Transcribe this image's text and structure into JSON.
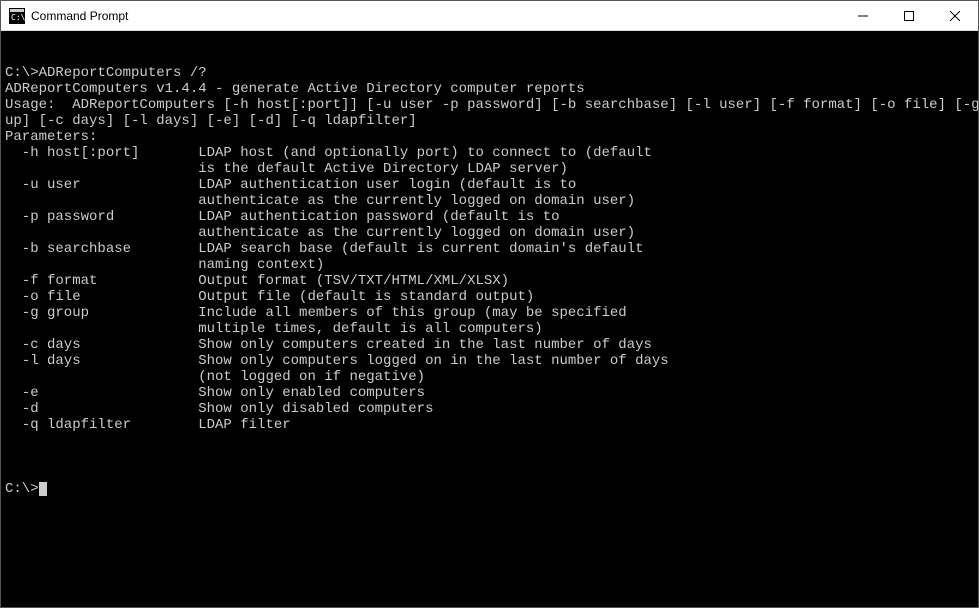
{
  "titlebar": {
    "title": "Command Prompt"
  },
  "terminal": {
    "lines": [
      "C:\\>ADReportComputers /?",
      "ADReportComputers v1.4.4 - generate Active Directory computer reports",
      "Usage:  ADReportComputers [-h host[:port]] [-u user -p password] [-b searchbase] [-l user] [-f format] [-o file] [-g gro",
      "up] [-c days] [-l days] [-e] [-d] [-q ldapfilter]",
      "Parameters:",
      "  -h host[:port]       LDAP host (and optionally port) to connect to (default",
      "                       is the default Active Directory LDAP server)",
      "  -u user              LDAP authentication user login (default is to",
      "                       authenticate as the currently logged on domain user)",
      "  -p password          LDAP authentication password (default is to",
      "                       authenticate as the currently logged on domain user)",
      "  -b searchbase        LDAP search base (default is current domain's default",
      "                       naming context)",
      "  -f format            Output format (TSV/TXT/HTML/XML/XLSX)",
      "  -o file              Output file (default is standard output)",
      "  -g group             Include all members of this group (may be specified",
      "                       multiple times, default is all computers)",
      "  -c days              Show only computers created in the last number of days",
      "  -l days              Show only computers logged on in the last number of days",
      "                       (not logged on if negative)",
      "  -e                   Show only enabled computers",
      "  -d                   Show only disabled computers",
      "  -q ldapfilter        LDAP filter",
      ""
    ],
    "prompt": "C:\\>"
  }
}
